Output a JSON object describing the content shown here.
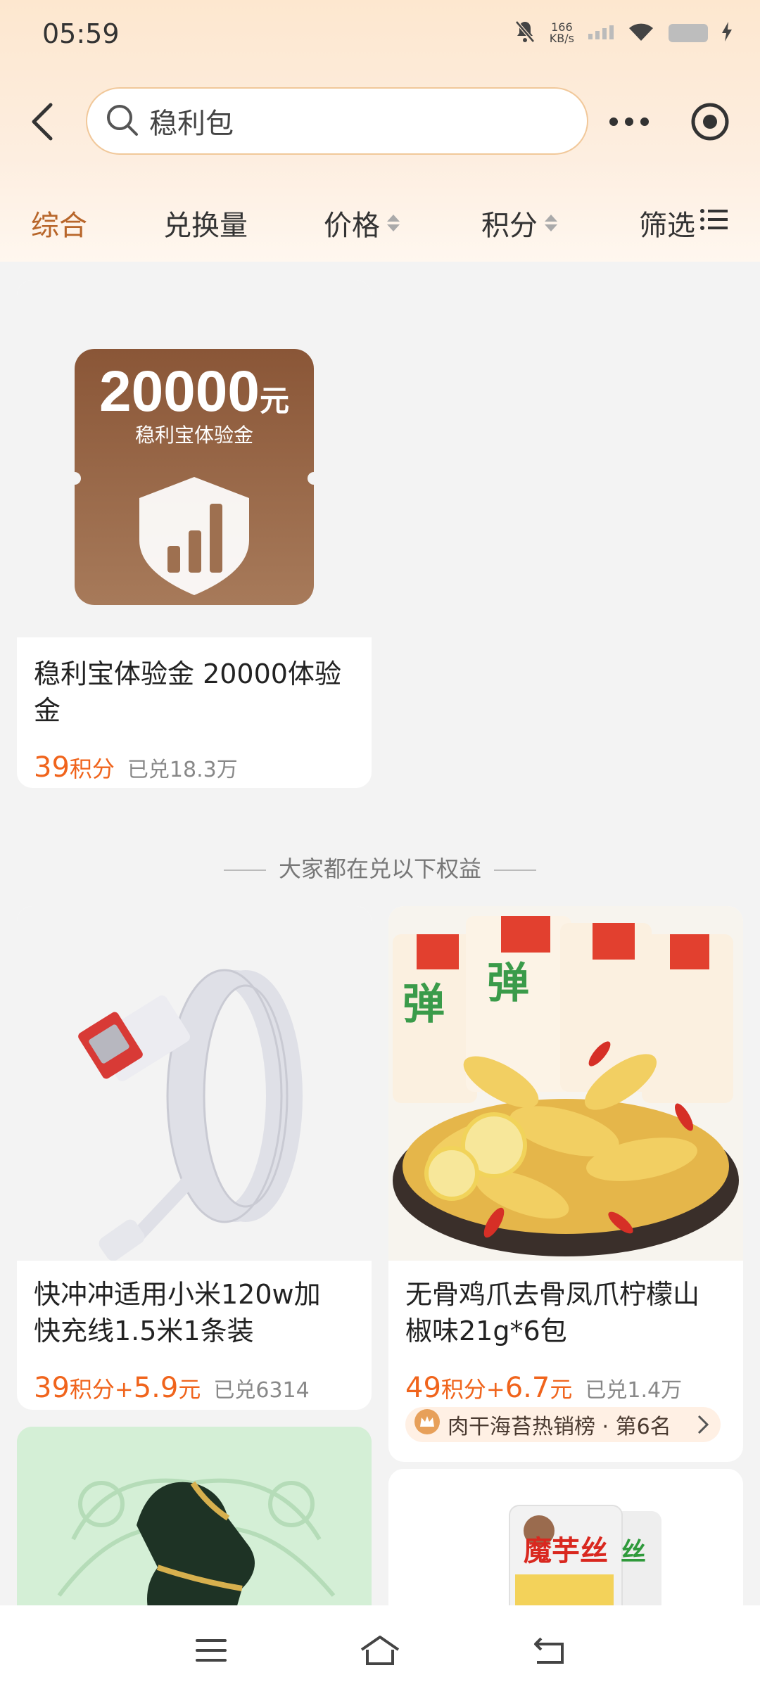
{
  "status_bar": {
    "time": "05:59",
    "network_speed_value": "166",
    "network_speed_unit": "KB/s"
  },
  "search": {
    "query": "稳利包"
  },
  "sort_tabs": [
    {
      "label": "综合",
      "active": true
    },
    {
      "label": "兑换量",
      "active": false
    },
    {
      "label": "价格",
      "active": false
    },
    {
      "label": "积分",
      "active": false
    },
    {
      "label": "筛选",
      "active": false
    }
  ],
  "products": [
    {
      "image_amount": "20000",
      "image_unit": "元",
      "image_subtitle": "稳利宝体验金",
      "title_line1": "稳利宝体验金 20000体验",
      "title_line2": "金",
      "price_points": "39",
      "price_points_unit": "积分",
      "sold": "已兑18.3万"
    },
    {
      "title_line1": "快冲冲适用小米120w加",
      "title_line2": "快充线1.5米1条装",
      "price_points": "39",
      "price_points_unit": "积分+",
      "price_cash": "5.9",
      "price_cash_unit": "元",
      "sold": "已兑6314"
    },
    {
      "title_line1": "无骨鸡爪去骨凤爪柠檬山",
      "title_line2": "椒味21g*6包",
      "price_points": "49",
      "price_points_unit": "积分+",
      "price_cash": "6.7",
      "price_cash_unit": "元",
      "sold": "已兑1.4万",
      "rank_text": "肉干海苔热销榜 · 第6名"
    },
    {
      "image_brand": "魔芋丝"
    }
  ],
  "divider_text": "大家都在兑以下权益",
  "colors": {
    "accent": "#f0641c",
    "active_tab": "#b8662a",
    "coupon": "#9a6444"
  }
}
